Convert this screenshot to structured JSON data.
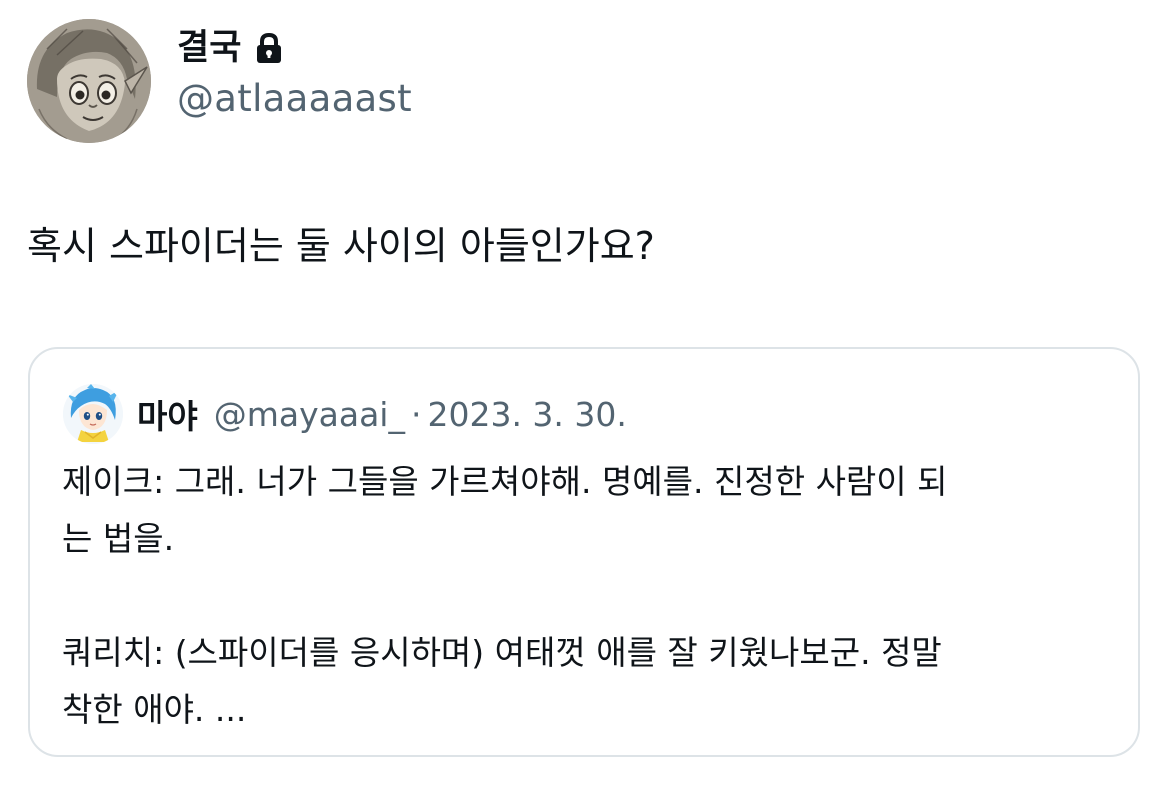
{
  "author": {
    "display_name": "결국",
    "handle": "@atlaaaaast",
    "protected_icon": "lock-icon",
    "avatar": "sketch-portrait-avatar"
  },
  "tweet": {
    "text": "혹시 스파이더는 둘 사이의 아들인가요?"
  },
  "quote": {
    "display_name": "마야",
    "handle": "@mayaaai_",
    "separator": "·",
    "date": "2023. 3. 30.",
    "avatar": "blue-hair-character-avatar",
    "lines": [
      "제이크: 그래. 너가 그들을 가르쳐야해. 명예를. 진정한 사람이 되",
      "는 법을.",
      "",
      "쿼리치: (스파이더를 응시하며) 여태껏 애를 잘 키웠나보군. 정말",
      "착한 애야. ..."
    ]
  },
  "colors": {
    "text_primary": "#0f1419",
    "text_secondary": "#536471",
    "border": "#dde3e7",
    "background": "#ffffff"
  }
}
